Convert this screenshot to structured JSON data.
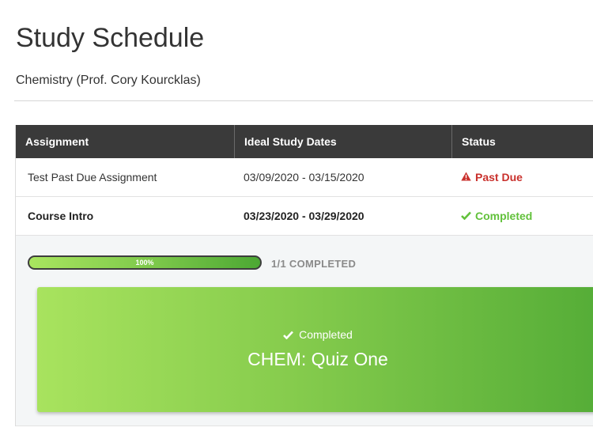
{
  "page": {
    "title": "Study Schedule",
    "course": "Chemistry (Prof. Cory Kourcklas)"
  },
  "table": {
    "headers": [
      "Assignment",
      "Ideal Study Dates",
      "Status"
    ],
    "rows": [
      {
        "assignment": "Test Past Due Assignment",
        "dates": "03/09/2020 - 03/15/2020",
        "status": "Past Due",
        "status_icon": "warning-icon",
        "status_color": "#c9302c"
      },
      {
        "assignment": "Course Intro",
        "dates": "03/23/2020 - 03/29/2020",
        "status": "Completed",
        "status_icon": "check-icon",
        "status_color": "#62c13b"
      }
    ]
  },
  "detail": {
    "progress_percent": 100,
    "progress_label": "100%",
    "progress_count": "1/1 COMPLETED",
    "quiz": {
      "status": "Completed",
      "status_icon": "check-icon",
      "title": "CHEM: Quiz One"
    }
  },
  "colors": {
    "header_bg": "#3a3a3a",
    "past_due": "#c9302c",
    "completed": "#62c13b",
    "card_gradient_start": "#a8e35e",
    "card_gradient_end": "#55ad37"
  }
}
